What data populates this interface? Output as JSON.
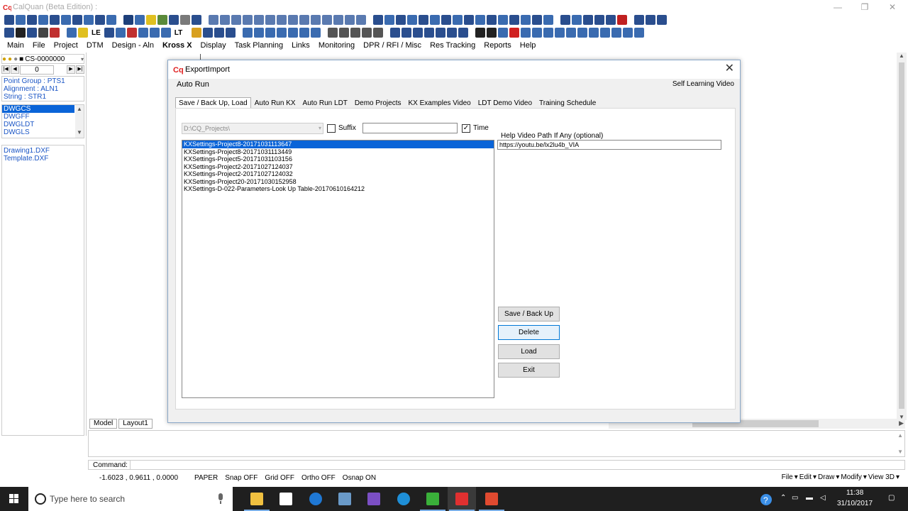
{
  "window": {
    "title": "CalQuan (Beta Edition) :",
    "minimize": "—",
    "maximize": "❐",
    "close": "✕"
  },
  "toolbar2": {
    "le_label": "LE",
    "lt_label": "LT"
  },
  "menu": [
    "Main",
    "File",
    "Project",
    "DTM",
    "Design - Aln",
    "Kross X",
    "Display",
    "Task Planning",
    "Links",
    "Monitoring",
    "DPR / RFI / Misc",
    "Res Tracking",
    "Reports",
    "Help"
  ],
  "left_panel": {
    "cs_value": "CS-0000000",
    "nav_value": "0",
    "info": [
      "Point Group : PTS1",
      "Alignment : ALN1",
      "String : STR1"
    ],
    "layers": [
      "DWGCS",
      "DWGFF",
      "DWGLDT",
      "DWGLS"
    ],
    "files": [
      "Drawing1.DXF",
      "Template.DXF"
    ]
  },
  "dialog": {
    "title": "ExportImport",
    "auto_run": "Auto Run",
    "self_learning": "Self Learning Video",
    "tabs": [
      "Save / Back Up, Load",
      "Auto Run KX",
      "Auto Run LDT",
      "Demo Projects",
      "KX Examples Video",
      "LDT Demo Video",
      "Training Schedule"
    ],
    "path_combo": "D:\\CQ_Projects\\",
    "suffix_label": "Suffix",
    "suffix_checked": false,
    "time_label": "Time",
    "time_checked": true,
    "help_label": "Help Video Path If Any (optional)",
    "help_value": "https://youtu.be/lx2lu4b_VIA",
    "list_items": [
      "KXSettings-Project8-20171031113647",
      "KXSettings-Project8-20171031113449",
      "KXSettings-Project5-20171031103156",
      "KXSettings-Project2-20171027124037",
      "KXSettings-Project2-20171027124032",
      "KXSettings-Project20-20171030152958",
      "KXSettings-D-022-Parameters-Look Up Table-20170610164212"
    ],
    "buttons": {
      "save": "Save / Back Up",
      "delete": "Delete",
      "load": "Load",
      "exit": "Exit"
    }
  },
  "tabs_bottom": [
    "Model",
    "Layout1"
  ],
  "command": {
    "label": "Command:"
  },
  "status": {
    "coords": "-1.6023 , 0.9611 , 0.0000",
    "items": [
      "PAPER",
      "Snap OFF",
      "Grid OFF",
      "Ortho OFF",
      "Osnap ON"
    ],
    "right_menu": [
      "File",
      "Edit",
      "Draw",
      "Modify",
      "View 3D"
    ]
  },
  "taskbar": {
    "search_placeholder": "Type here to search",
    "time": "11:38",
    "date": "31/10/2017"
  },
  "colors": {
    "accent_blue": "#0a64d8",
    "link_blue": "#1a55c5",
    "taskbar": "#1f1f1f"
  }
}
